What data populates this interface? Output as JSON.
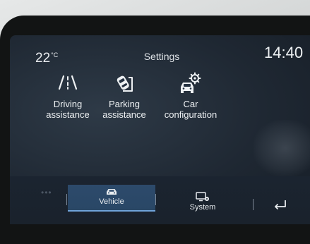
{
  "status_bar": {
    "temperature": "22",
    "temperature_unit": "°C",
    "title": "Settings",
    "time": "14:40"
  },
  "menu": {
    "items": [
      {
        "label_line1": "Driving",
        "label_line2": "assistance",
        "icon": "road-lanes-icon"
      },
      {
        "label_line1": "Parking",
        "label_line2": "assistance",
        "icon": "parking-car-icon"
      },
      {
        "label_line1": "Car",
        "label_line2": "configuration",
        "icon": "car-gear-icon"
      }
    ]
  },
  "dock": {
    "tabs": [
      {
        "label": "Vehicle",
        "icon": "car-icon",
        "selected": true
      },
      {
        "label": "System",
        "icon": "display-gear-icon",
        "selected": false
      }
    ],
    "back_icon": "back-arrow-icon",
    "more_icon": "more-dots-icon"
  },
  "colors": {
    "screen_bg": "#1f2833",
    "text": "#eef1f3",
    "selected_tab": "#2d4a6b",
    "selected_underline": "#6fa3d8"
  }
}
